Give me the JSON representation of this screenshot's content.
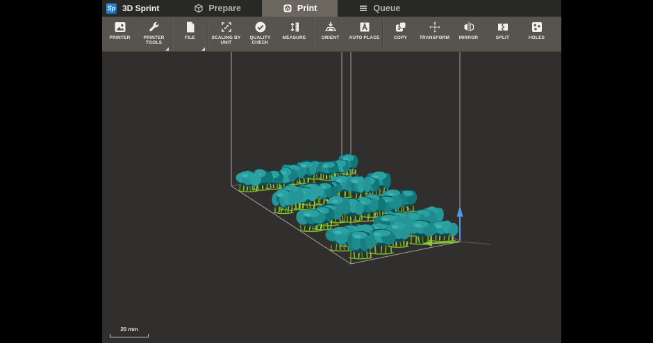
{
  "app": {
    "logo_text": "Sp",
    "title": "3D Sprint"
  },
  "tabs": [
    {
      "id": "prepare",
      "label": "Prepare",
      "icon": "cube-icon",
      "active": false
    },
    {
      "id": "print",
      "label": "Print",
      "icon": "print-tab-icon",
      "active": true
    },
    {
      "id": "queue",
      "label": "Queue",
      "icon": "queue-icon",
      "active": false
    }
  ],
  "toolbar": {
    "groups": [
      {
        "items": [
          {
            "label": "PRINTER",
            "icon": "printer-icon",
            "has_submenu": false
          },
          {
            "label": "PRINTER TOOLS",
            "icon": "wrench-icon",
            "has_submenu": true
          }
        ]
      },
      {
        "items": [
          {
            "label": "FILE",
            "icon": "file-icon",
            "has_submenu": true
          }
        ]
      },
      {
        "items": [
          {
            "label": "SCALING BY UNIT",
            "icon": "scaling-icon",
            "has_submenu": false
          },
          {
            "label": "QUALITY CHECK",
            "icon": "quality-icon",
            "has_submenu": false
          },
          {
            "label": "MEASURE",
            "icon": "measure-icon",
            "has_submenu": false
          }
        ]
      },
      {
        "items": [
          {
            "label": "ORIENT",
            "icon": "orient-icon",
            "has_submenu": false
          },
          {
            "label": "AUTO PLACE",
            "icon": "autoplace-icon",
            "has_submenu": false
          }
        ]
      },
      {
        "items": [
          {
            "label": "COPY",
            "icon": "copy-icon",
            "has_submenu": false
          },
          {
            "label": "TRANSFORM",
            "icon": "transform-icon",
            "has_submenu": false
          },
          {
            "label": "MIRROR",
            "icon": "mirror-icon",
            "has_submenu": false
          },
          {
            "label": "SPLIT",
            "icon": "split-icon",
            "has_submenu": false
          },
          {
            "label": "HOLES",
            "icon": "holes-icon",
            "has_submenu": false
          }
        ]
      }
    ]
  },
  "viewport": {
    "scale_label": "20 mm",
    "colors": {
      "background": "#312f2e",
      "wireframe": "#a6a3a0",
      "model_teal": "#1e8b8d",
      "model_teal_dark": "#0b4f54",
      "support_green": "#79ba2d",
      "axis_z_blue": "#4d9be6",
      "axis_x_green": "#8bc73c"
    }
  }
}
